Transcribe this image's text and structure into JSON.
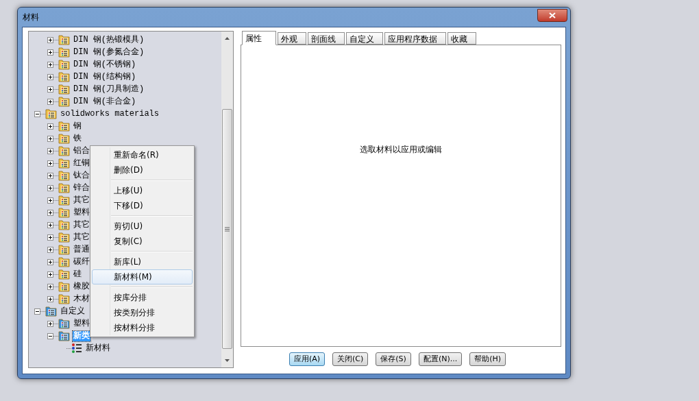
{
  "window": {
    "title": "材料"
  },
  "tree": {
    "items": [
      {
        "children": [
          {
            "label": "DIN 钢(热锻模具)",
            "kind": "folder",
            "expanded": false,
            "selected": false
          },
          {
            "label": "DIN 钢(参氮合金)",
            "kind": "folder",
            "expanded": false,
            "selected": false
          },
          {
            "label": "DIN 钢(不锈钢)",
            "kind": "folder",
            "expanded": false,
            "selected": false
          },
          {
            "label": "DIN 钢(结构钢)",
            "kind": "folder",
            "expanded": false,
            "selected": false
          },
          {
            "label": "DIN 钢(刀具制造)",
            "kind": "folder",
            "expanded": false,
            "selected": false
          },
          {
            "label": "DIN 钢(非合金)",
            "kind": "folder",
            "expanded": false,
            "selected": false
          }
        ]
      },
      {
        "label": "solidworks materials",
        "kind": "folder",
        "expanded": true,
        "selected": false,
        "children": [
          {
            "label": "钢",
            "kind": "folder",
            "expanded": false,
            "selected": false
          },
          {
            "label": "铁",
            "kind": "folder",
            "expanded": false,
            "selected": false
          },
          {
            "label": "铝合",
            "kind": "folder",
            "expanded": false,
            "selected": false
          },
          {
            "label": "红铜",
            "kind": "folder",
            "expanded": false,
            "selected": false
          },
          {
            "label": "钛合",
            "kind": "folder",
            "expanded": false,
            "selected": false
          },
          {
            "label": "锌合",
            "kind": "folder",
            "expanded": false,
            "selected": false
          },
          {
            "label": "其它",
            "kind": "folder",
            "expanded": false,
            "selected": false
          },
          {
            "label": "塑料",
            "kind": "folder",
            "expanded": false,
            "selected": false
          },
          {
            "label": "其它",
            "kind": "folder",
            "expanded": false,
            "selected": false
          },
          {
            "label": "其它",
            "kind": "folder",
            "expanded": false,
            "selected": false
          },
          {
            "label": "普通",
            "kind": "folder",
            "expanded": false,
            "selected": false
          },
          {
            "label": "碳纤",
            "kind": "folder",
            "expanded": false,
            "selected": false
          },
          {
            "label": "硅",
            "kind": "folder",
            "expanded": false,
            "selected": false
          },
          {
            "label": "橡胶",
            "kind": "folder",
            "expanded": false,
            "selected": false
          },
          {
            "label": "木材",
            "kind": "folder",
            "expanded": false,
            "selected": false
          }
        ]
      },
      {
        "label": "自定义",
        "kind": "custom_folder",
        "expanded": true,
        "selected": false,
        "children": [
          {
            "label": "塑料",
            "kind": "custom_folder",
            "expanded": false,
            "selected": false
          },
          {
            "label": "新类",
            "kind": "custom_folder",
            "expanded": true,
            "selected": true,
            "children": [
              {
                "label": "新材料",
                "kind": "material",
                "selected": false
              }
            ]
          }
        ]
      }
    ]
  },
  "context_menu": {
    "groups": [
      [
        {
          "label": "重新命名(R)",
          "highlighted": false
        },
        {
          "label": "删除(D)",
          "highlighted": false
        }
      ],
      [
        {
          "label": "上移(U)",
          "highlighted": false
        },
        {
          "label": "下移(D)",
          "highlighted": false
        }
      ],
      [
        {
          "label": "剪切(U)",
          "highlighted": false
        },
        {
          "label": "复制(C)",
          "highlighted": false
        }
      ],
      [
        {
          "label": "新库(L)",
          "highlighted": false
        },
        {
          "label": "新材料(M)",
          "highlighted": true
        }
      ],
      [
        {
          "label": "按库分排",
          "highlighted": false
        },
        {
          "label": "按类别分排",
          "highlighted": false
        },
        {
          "label": "按材料分排",
          "highlighted": false
        }
      ]
    ]
  },
  "tabs": [
    {
      "label": "属性",
      "selected": true
    },
    {
      "label": "外观",
      "selected": false
    },
    {
      "label": "剖面线",
      "selected": false
    },
    {
      "label": "自定义",
      "selected": false
    },
    {
      "label": "应用程序数据",
      "selected": false
    },
    {
      "label": "收藏",
      "selected": false
    }
  ],
  "message": "选取材料以应用或编辑",
  "buttons": [
    {
      "label": "应用(A)",
      "default": true
    },
    {
      "label": "关闭(C)",
      "default": false
    },
    {
      "label": "保存(S)",
      "default": false
    },
    {
      "label": "配置(N)...",
      "default": false
    },
    {
      "label": "帮助(H)",
      "default": false
    }
  ]
}
